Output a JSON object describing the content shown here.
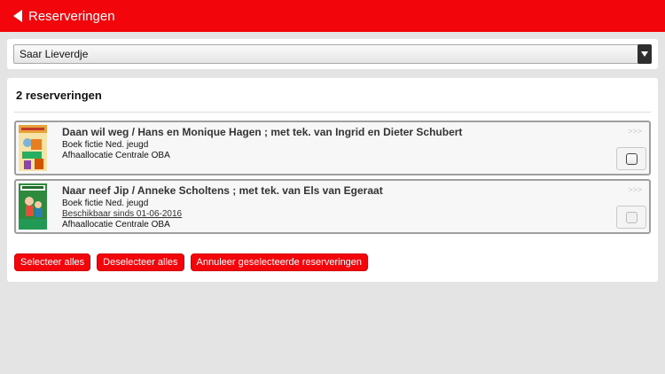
{
  "header": {
    "title": "Reserveringen",
    "back_icon": "back-arrow-icon"
  },
  "member_select": {
    "value": "Saar Lieverdje",
    "icon": "dropdown-arrow-icon"
  },
  "reservations": {
    "heading": "2 reserveringen",
    "items": [
      {
        "title": "Daan wil weg / Hans en Monique Hagen ; met tek. van Ingrid en Dieter Schubert",
        "type": "Boek fictie Ned. jeugd",
        "availability": "",
        "location": "Afhaallocatie Centrale OBA",
        "more": ">>>",
        "selectable": true
      },
      {
        "title": "Naar neef Jip / Anneke Scholtens ; met tek. van Els van Egeraat",
        "type": "Boek fictie Ned. jeugd",
        "availability": "Beschikbaar sinds 01-06-2016",
        "location": "Afhaallocatie Centrale OBA",
        "more": ">>>",
        "selectable": false
      }
    ]
  },
  "actions": {
    "select_all": "Selecteer alles",
    "deselect_all": "Deselecteer alles",
    "cancel_selected": "Annuleer geselecteerde reserveringen"
  },
  "colors": {
    "brand": "#f2050b",
    "background": "#e4e4e4"
  }
}
